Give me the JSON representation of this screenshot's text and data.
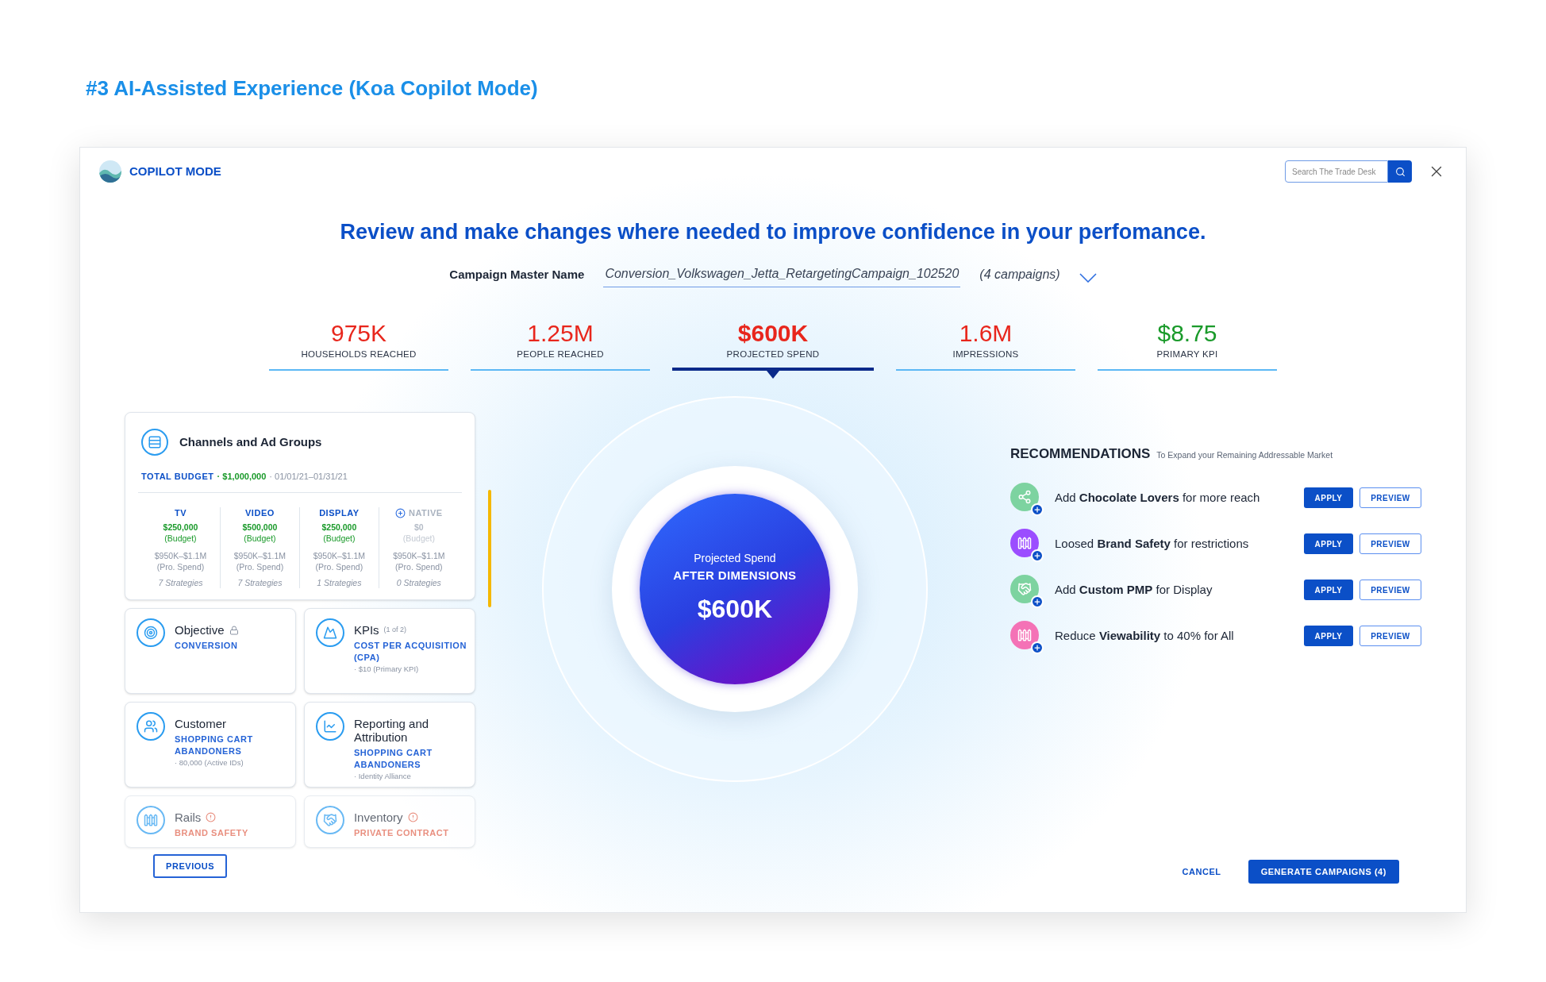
{
  "page_heading": "#3 AI-Assisted Experience (Koa Copilot Mode)",
  "header": {
    "mode_label": "COPILOT MODE",
    "search": {
      "placeholder": "Search The Trade Desk"
    }
  },
  "title": "Review and make changes where needed to improve confidence in your perfomance.",
  "campaign": {
    "label": "Campaign Master Name",
    "value": "Conversion_Volkswagen_Jetta_RetargetingCampaign_102520",
    "count": "(4 campaigns)"
  },
  "metrics": [
    {
      "value": "975K",
      "label": "HOUSEHOLDS REACHED",
      "selected": false,
      "color": "#e8261c"
    },
    {
      "value": "1.25M",
      "label": "PEOPLE REACHED",
      "selected": false,
      "color": "#e8261c"
    },
    {
      "value": "$600K",
      "label": "PROJECTED SPEND",
      "selected": true,
      "color": "#e8261c"
    },
    {
      "value": "1.6M",
      "label": "IMPRESSIONS",
      "selected": false,
      "color": "#e8261c"
    },
    {
      "value": "$8.75",
      "label": "PRIMARY KPI",
      "selected": false,
      "color": "#1a9a2a"
    }
  ],
  "channels_card": {
    "title": "Channels and Ad Groups",
    "budget_label": "TOTAL BUDGET",
    "budget": "· $1,000,000",
    "dates": "· 01/01/21–01/31/21",
    "channels": [
      {
        "name": "TV",
        "budget": "$250,000",
        "budget_note": "(Budget)",
        "spend": "$950K–$1.1M",
        "spend_note": "(Pro. Spend)",
        "strategies": "7 Strategies",
        "active": true
      },
      {
        "name": "VIDEO",
        "budget": "$500,000",
        "budget_note": "(Budget)",
        "spend": "$950K–$1.1M",
        "spend_note": "(Pro. Spend)",
        "strategies": "7 Strategies",
        "active": true
      },
      {
        "name": "DISPLAY",
        "budget": "$250,000",
        "budget_note": "(Budget)",
        "spend": "$950K–$1.1M",
        "spend_note": "(Pro. Spend)",
        "strategies": "1 Strategies",
        "active": true
      },
      {
        "name": "NATIVE",
        "budget": "$0",
        "budget_note": "(Budget)",
        "spend": "$950K–$1.1M",
        "spend_note": "(Pro. Spend)",
        "strategies": "0 Strategies",
        "active": false
      }
    ]
  },
  "cards": [
    {
      "kind": "objective",
      "title": "Objective",
      "locked": true,
      "value": "CONVERSION",
      "faded": false
    },
    {
      "kind": "kpi",
      "title": "KPIs",
      "count": "(1 of 2)",
      "value": "COST PER ACQUISITION (CPA)",
      "note": "· $10 (Primary KPI)",
      "faded": false
    },
    {
      "kind": "customer",
      "title": "Customer",
      "value": "SHOPPING CART ABANDONERS",
      "note": "· 80,000 (Active IDs)",
      "faded": false
    },
    {
      "kind": "reporting",
      "title": "Reporting and Attribution",
      "value": "SHOPPING CART ABANDONERS",
      "note": "· Identity Alliance",
      "faded": false
    },
    {
      "kind": "rails",
      "title": "Rails",
      "warning": true,
      "value": "BRAND SAFETY",
      "faded": true
    },
    {
      "kind": "inventory",
      "title": "Inventory",
      "warning": true,
      "value": "PRIVATE CONTRACT",
      "faded": true
    }
  ],
  "center": {
    "caption": "Projected Spend",
    "subtitle": "AFTER DIMENSIONS",
    "value": "$600K"
  },
  "recommendations": {
    "title": "RECOMMENDATIONS",
    "subtitle": "To Expand your Remaining Addressable Market",
    "items": [
      {
        "kind": "network",
        "color": "#7dd3a0",
        "text": "Add **Chocolate Lovers** for more reach",
        "apply": "APPLY",
        "preview": "PREVIEW"
      },
      {
        "kind": "rails",
        "color": "#9b4dff",
        "text": "Loosed **Brand Safety** for restrictions",
        "apply": "APPLY",
        "preview": "PREVIEW"
      },
      {
        "kind": "handshake",
        "color": "#7dd3a0",
        "text": "Add **Custom PMP** for Display",
        "apply": "APPLY",
        "preview": "PREVIEW"
      },
      {
        "kind": "rails",
        "color": "#f472b6",
        "text": "Reduce **Viewability** to 40% for All",
        "apply": "APPLY",
        "preview": "PREVIEW"
      }
    ]
  },
  "footer": {
    "previous": "PREVIOUS",
    "cancel": "CANCEL",
    "generate": "GENERATE CAMPAIGNS (4)"
  }
}
